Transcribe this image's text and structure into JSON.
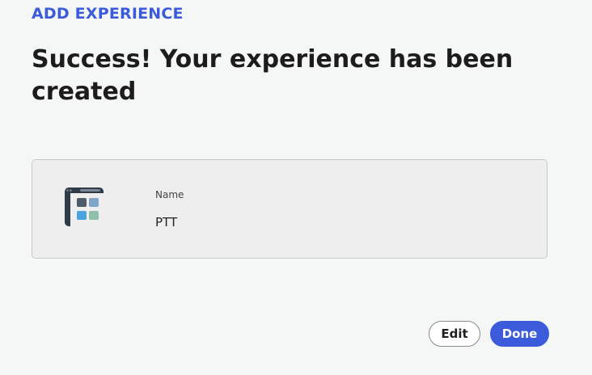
{
  "header": {
    "eyebrow": "ADD EXPERIENCE",
    "title": "Success! Your experience has been created"
  },
  "experience_card": {
    "icon": "experience-app-icon",
    "name_label": "Name",
    "name_value": "PTT"
  },
  "actions": {
    "edit_label": "Edit",
    "done_label": "Done"
  },
  "colors": {
    "accent": "#3b5bdb",
    "background": "#f5f6f6",
    "card_background": "#eeeeee"
  }
}
